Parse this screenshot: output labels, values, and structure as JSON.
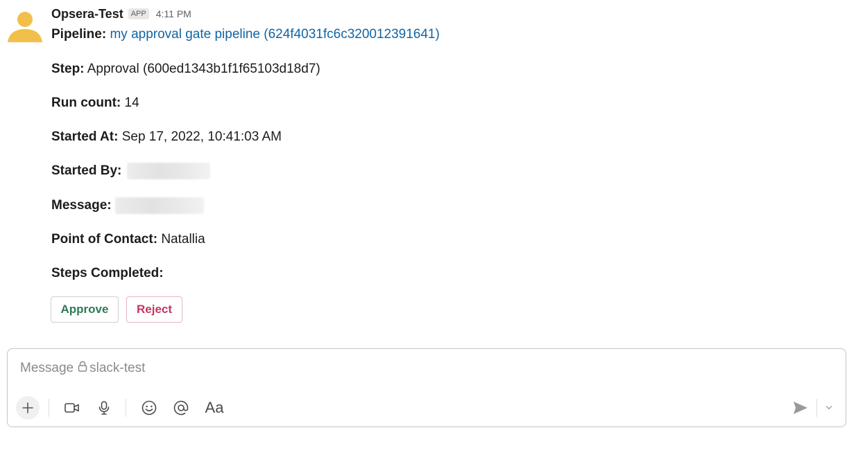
{
  "message": {
    "sender": "Opsera-Test",
    "badge": "APP",
    "time": "4:11 PM",
    "pipeline": {
      "label": "Pipeline:",
      "value": "my approval gate pipeline (624f4031fc6c320012391641)"
    },
    "step": {
      "label": "Step:",
      "value": "Approval (600ed1343b1f1f65103d18d7)"
    },
    "run_count": {
      "label": "Run count:",
      "value": "14"
    },
    "started_at": {
      "label": "Started At:",
      "value": "Sep 17, 2022, 10:41:03 AM"
    },
    "started_by": {
      "label": "Started By:"
    },
    "msg": {
      "label": "Message:"
    },
    "point_of_contact": {
      "label": "Point of Contact:",
      "value": "Natallia"
    },
    "steps_completed": {
      "label": "Steps Completed:"
    },
    "approve_label": "Approve",
    "reject_label": "Reject"
  },
  "composer": {
    "placeholder": "Message",
    "channel": "slack-test",
    "format_label": "Aa"
  },
  "icons": [
    "user-avatar-icon",
    "lock-icon",
    "plus-icon",
    "video-icon",
    "microphone-icon",
    "emoji-icon",
    "mention-icon",
    "send-icon",
    "chevron-down-icon"
  ],
  "colors": {
    "link": "#1264a3",
    "approve": "#2e7a55",
    "reject": "#c2365f"
  }
}
